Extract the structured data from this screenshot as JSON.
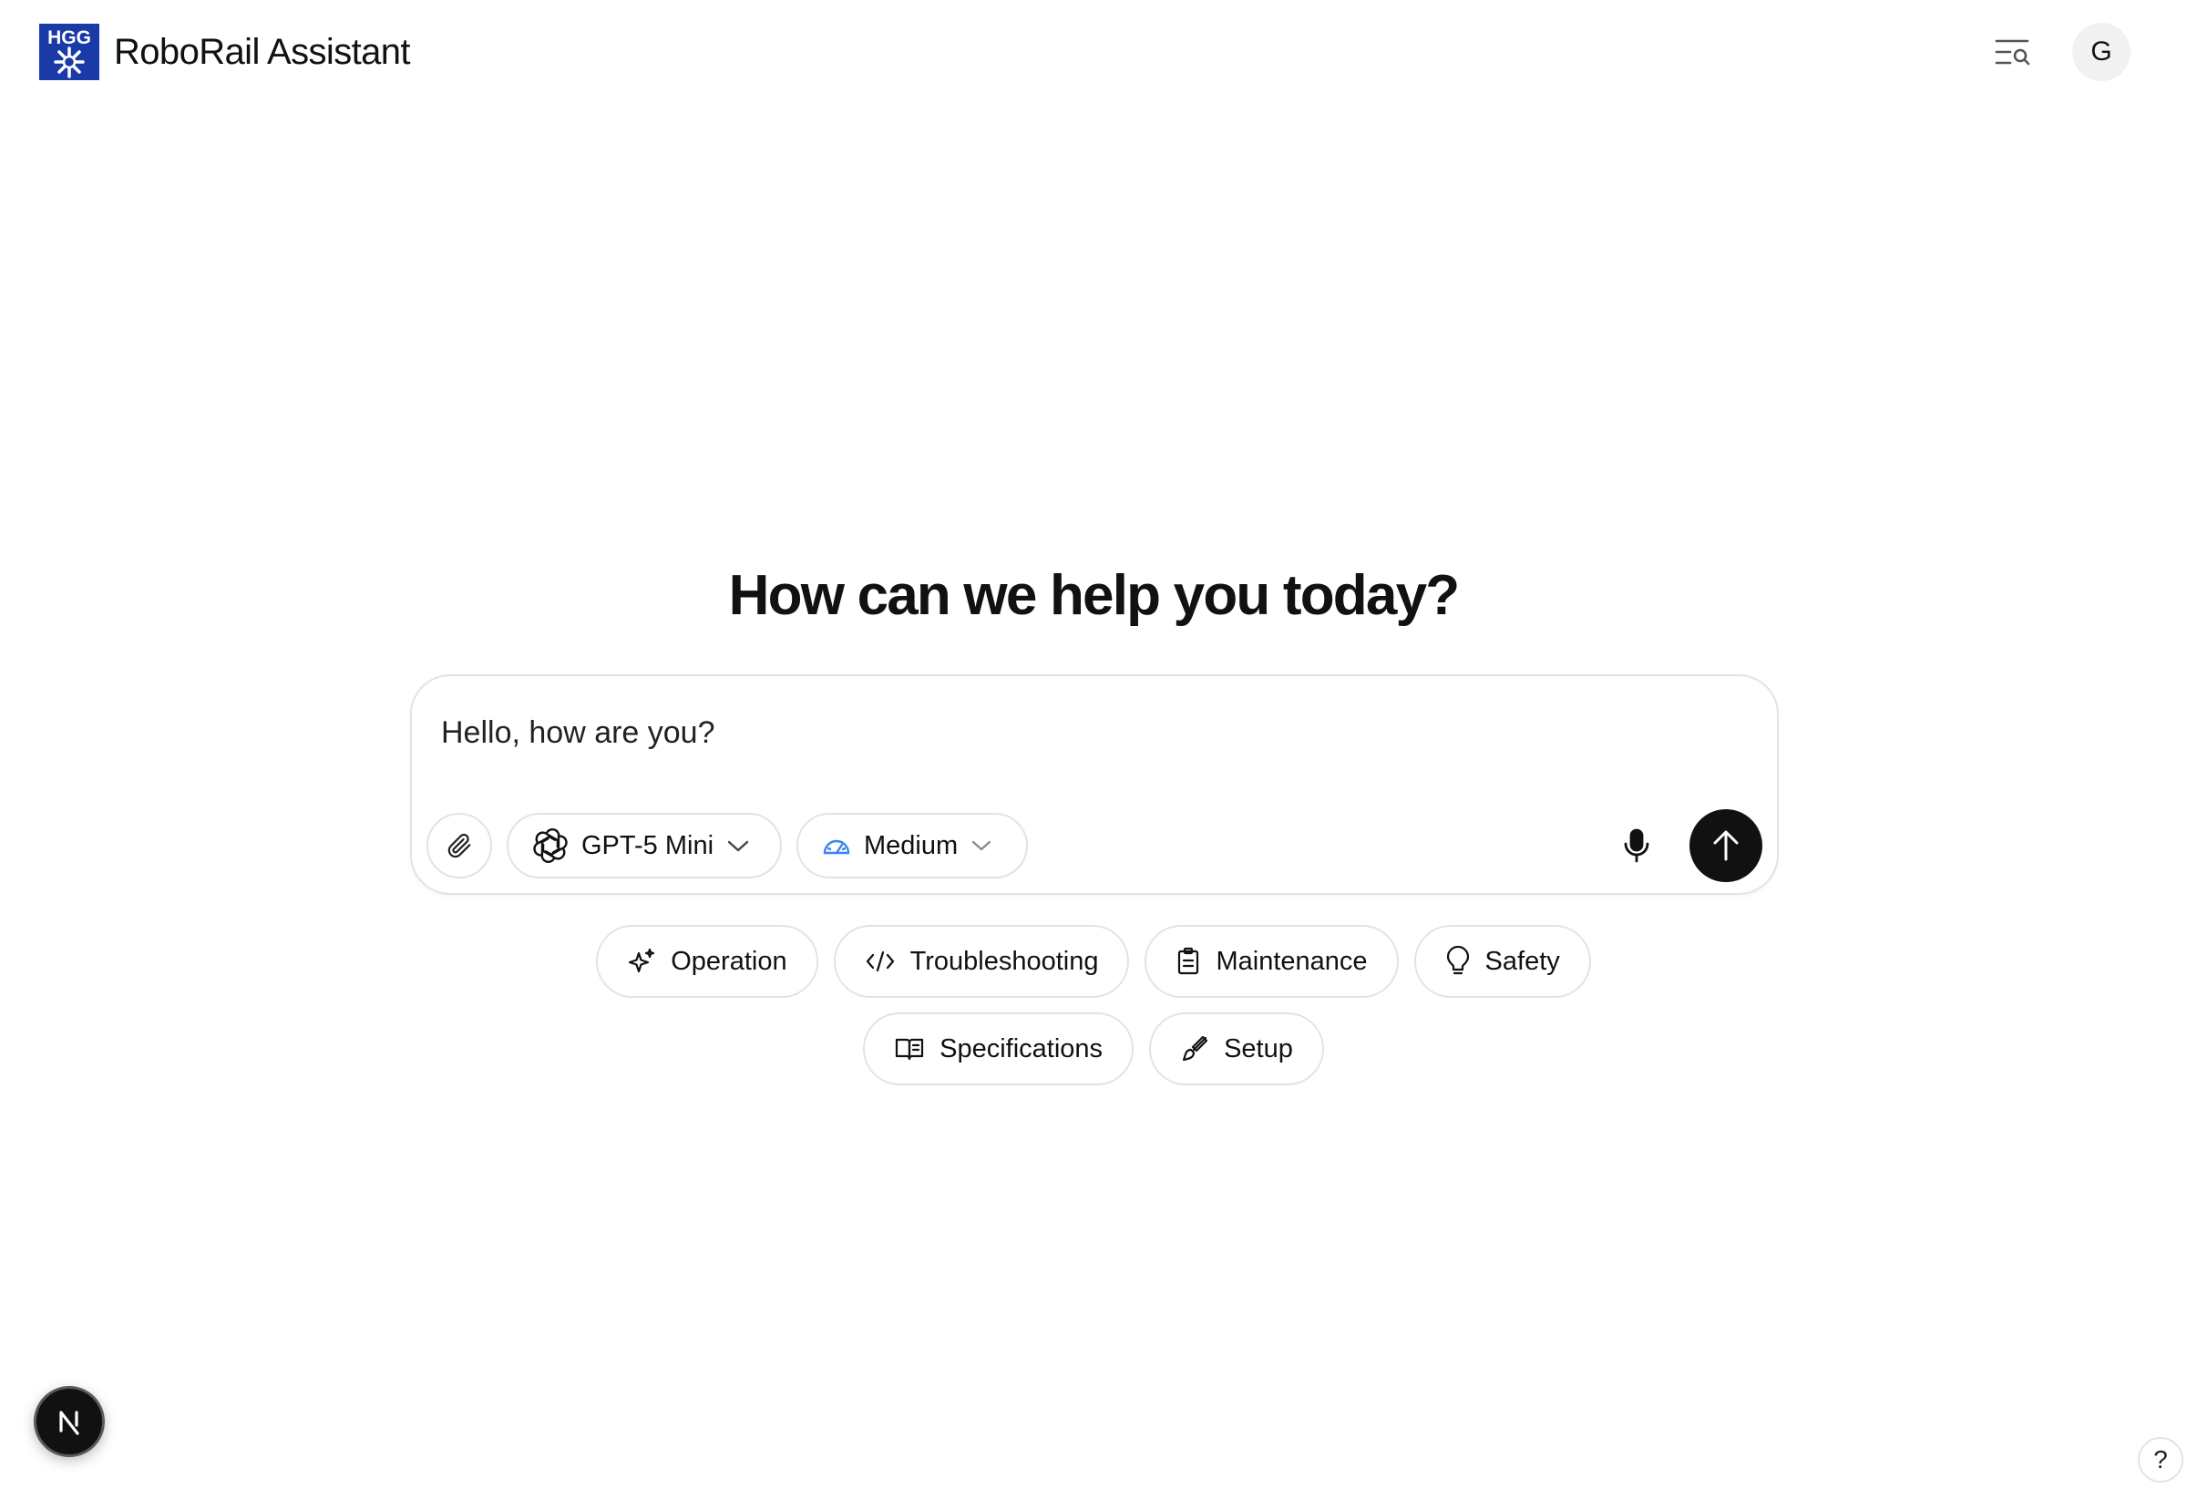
{
  "header": {
    "logo_text": "HGG",
    "app_title": "RoboRail Assistant",
    "search_icon": "history-search-icon",
    "user_avatar_initial": "G"
  },
  "main": {
    "heading": "How can we help you today?"
  },
  "composer": {
    "input_value": "Hello, how are you?",
    "attach_icon": "paperclip-icon",
    "model_select": {
      "value": "GPT-5 Mini",
      "icon": "openai-icon"
    },
    "effort_select": {
      "value": "Medium",
      "icon": "gauge-icon"
    },
    "mic_icon": "microphone-icon",
    "send_icon": "arrow-up-icon"
  },
  "suggestions": {
    "rows": [
      [
        {
          "label": "Operation",
          "icon": "sparkles-icon"
        },
        {
          "label": "Troubleshooting",
          "icon": "code-icon"
        },
        {
          "label": "Maintenance",
          "icon": "clipboard-icon"
        },
        {
          "label": "Safety",
          "icon": "lightbulb-icon"
        }
      ],
      [
        {
          "label": "Specifications",
          "icon": "book-icon"
        },
        {
          "label": "Setup",
          "icon": "brush-icon"
        }
      ]
    ]
  },
  "footer": {
    "next_badge_letter": "N",
    "help_label": "?"
  },
  "colors": {
    "brand_blue": "#1a3aa8",
    "text": "#111111",
    "border": "#e3e3e3",
    "send_button": "#111111",
    "gauge_blue": "#3b82f6"
  }
}
